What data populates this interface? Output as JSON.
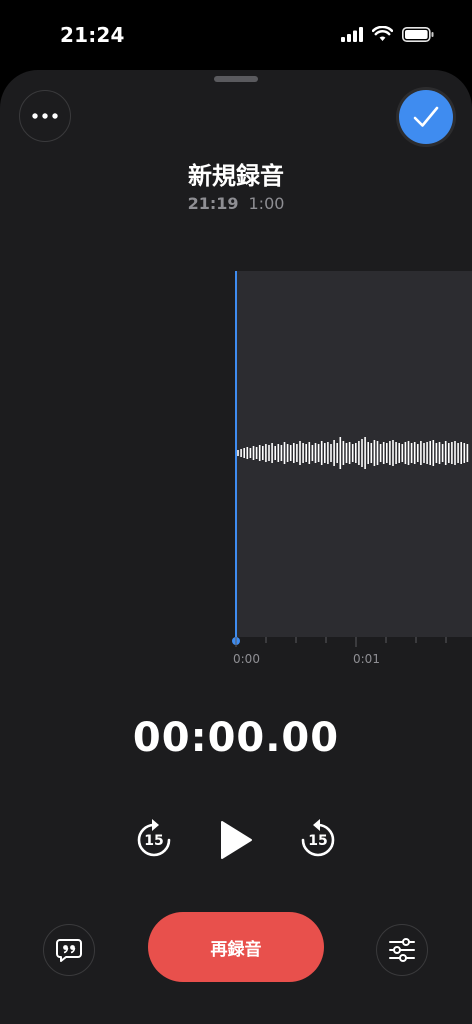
{
  "status_bar": {
    "time": "21:24",
    "icons": [
      "signal-icon",
      "wifi-icon",
      "battery-icon"
    ]
  },
  "header": {
    "title": "新規録音",
    "date": "21:19",
    "duration": "1:00"
  },
  "timeline": {
    "ticks": [
      "0:00",
      "0:01"
    ]
  },
  "playback": {
    "elapsed": "00:00.00",
    "skip_back": "15",
    "skip_forward": "15"
  },
  "actions": {
    "rerecord_label": "再録音"
  },
  "colors": {
    "accent_blue": "#3f8cf0",
    "record_red": "#e8504c",
    "sheet_bg": "#1c1c1e"
  }
}
